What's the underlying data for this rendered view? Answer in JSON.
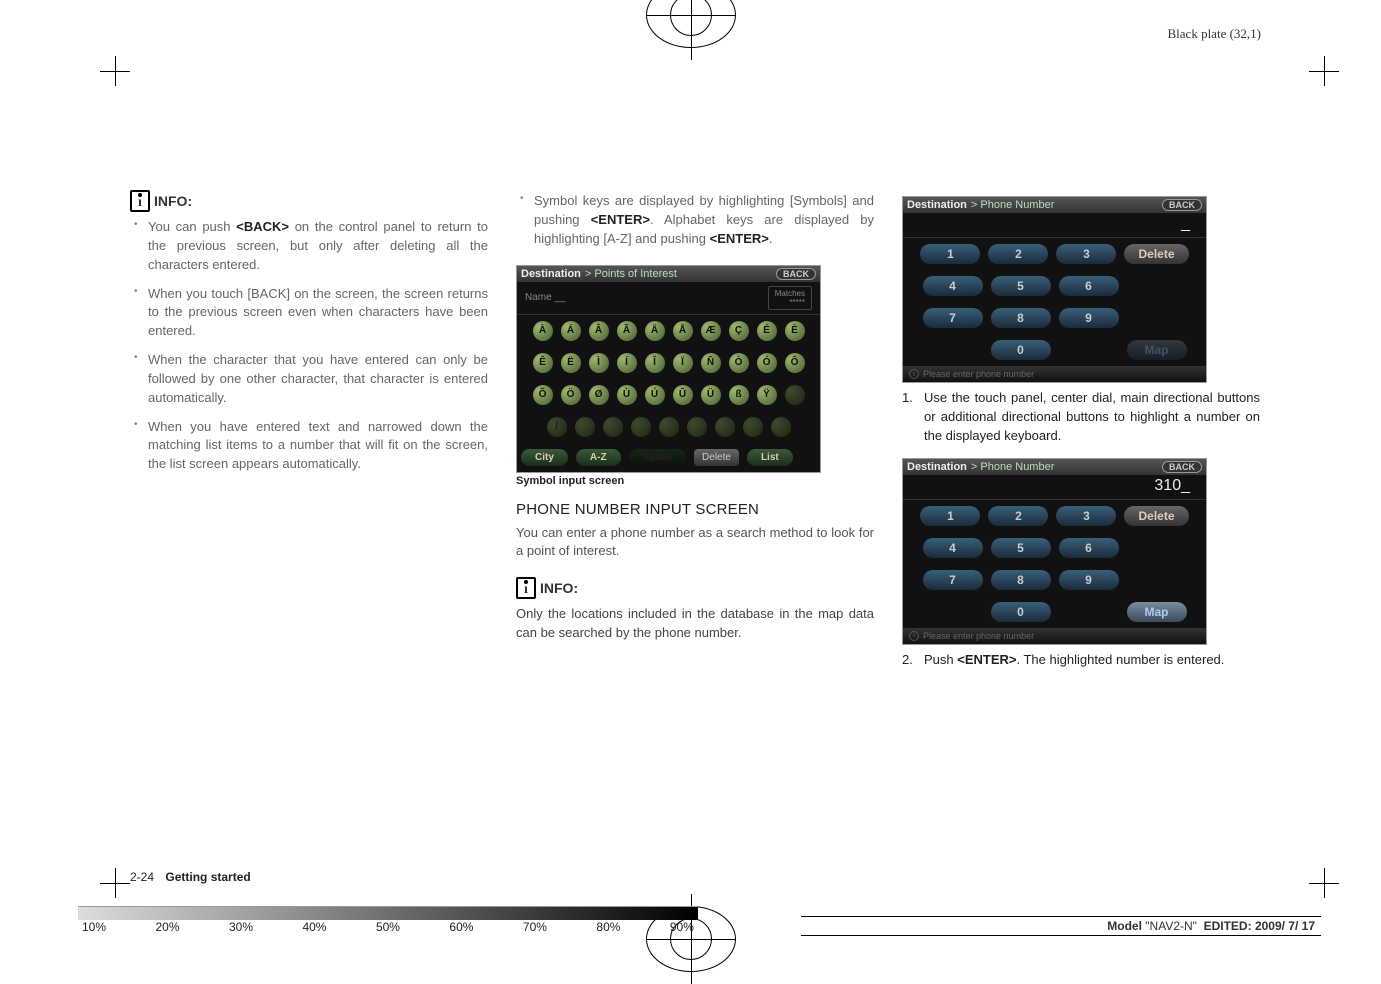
{
  "header_right": "Black plate (32,1)",
  "col1": {
    "info_label": "INFO:",
    "bullets": [
      "You can push <BACK> on the control panel to return to the previous screen, but only after deleting all the characters entered.",
      "When you touch [BACK] on the screen, the screen returns to the previous screen even when characters have been entered.",
      "When the character that you have entered can only be followed by one other character, that character is entered automatically.",
      "When you have entered text and narrowed down the matching list items to a number that will fit on the screen, the list screen appears automatically."
    ]
  },
  "col2": {
    "top_bullet": "Symbol keys are displayed by highlighting [Symbols] and pushing <ENTER>. Alphabet keys are displayed by highlighting [A-Z] and pushing <ENTER>.",
    "screenshot": {
      "title": "Destination",
      "sub": "> Points of Interest",
      "back": "BACK",
      "name_label": "Name",
      "name_val": "__",
      "matches_label": "Matches",
      "matches_val": "*****",
      "rows": [
        [
          "À",
          "Á",
          "Â",
          "Ã",
          "Ä",
          "Å",
          "Æ",
          "Ç",
          "É",
          "È"
        ],
        [
          "Ê",
          "Ë",
          "Ì",
          "Í",
          "Î",
          "Ï",
          "Ñ",
          "Ò",
          "Ó",
          "Ô"
        ],
        [
          "Õ",
          "Ö",
          "Ø",
          "Ù",
          "Ú",
          "Û",
          "Ü",
          "ß",
          "Ÿ",
          ""
        ]
      ],
      "dim_row": [
        "/",
        "",
        "",
        "",
        "",
        "",
        "",
        "",
        ""
      ],
      "bottom": {
        "city": "City",
        "az": "A-Z",
        "space": "Space",
        "delete": "Delete",
        "list": "List"
      }
    },
    "caption": "Symbol input screen",
    "subhead": "PHONE NUMBER INPUT SCREEN",
    "para1": "You can enter a phone number as a search method to look for a point of interest.",
    "info_label": "INFO:",
    "para2": "Only the locations included in the database in the map data can be searched by the phone number."
  },
  "col3": {
    "ss1": {
      "title": "Destination",
      "sub": "> Phone Number",
      "back": "BACK",
      "input": "_",
      "rows": [
        [
          "1",
          "2",
          "3",
          "Delete"
        ],
        [
          "4",
          "5",
          "6",
          ""
        ],
        [
          "7",
          "8",
          "9",
          ""
        ],
        [
          "",
          "0",
          "",
          "Map"
        ]
      ],
      "footer": "Please enter phone number"
    },
    "step1": "Use the touch panel, center dial, main directional buttons or additional directional buttons to highlight a number on the displayed keyboard.",
    "ss2": {
      "title": "Destination",
      "sub": "> Phone Number",
      "back": "BACK",
      "input": "310_",
      "rows": [
        [
          "1",
          "2",
          "3",
          "Delete"
        ],
        [
          "4",
          "5",
          "6",
          ""
        ],
        [
          "7",
          "8",
          "9",
          ""
        ],
        [
          "",
          "0",
          "",
          "Map"
        ]
      ],
      "footer": "Please enter phone number"
    },
    "step2": "Push <ENTER>. The highlighted number is entered."
  },
  "footer_left": {
    "page": "2-24",
    "section": "Getting started"
  },
  "footer_right": {
    "model_lbl": "Model",
    "model": "\"NAV2-N\"",
    "edited_lbl": "EDITED:",
    "date": "2009/ 7/ 17"
  },
  "ticks": [
    "10%",
    "20%",
    "30%",
    "40%",
    "50%",
    "60%",
    "70%",
    "80%",
    "90%"
  ]
}
